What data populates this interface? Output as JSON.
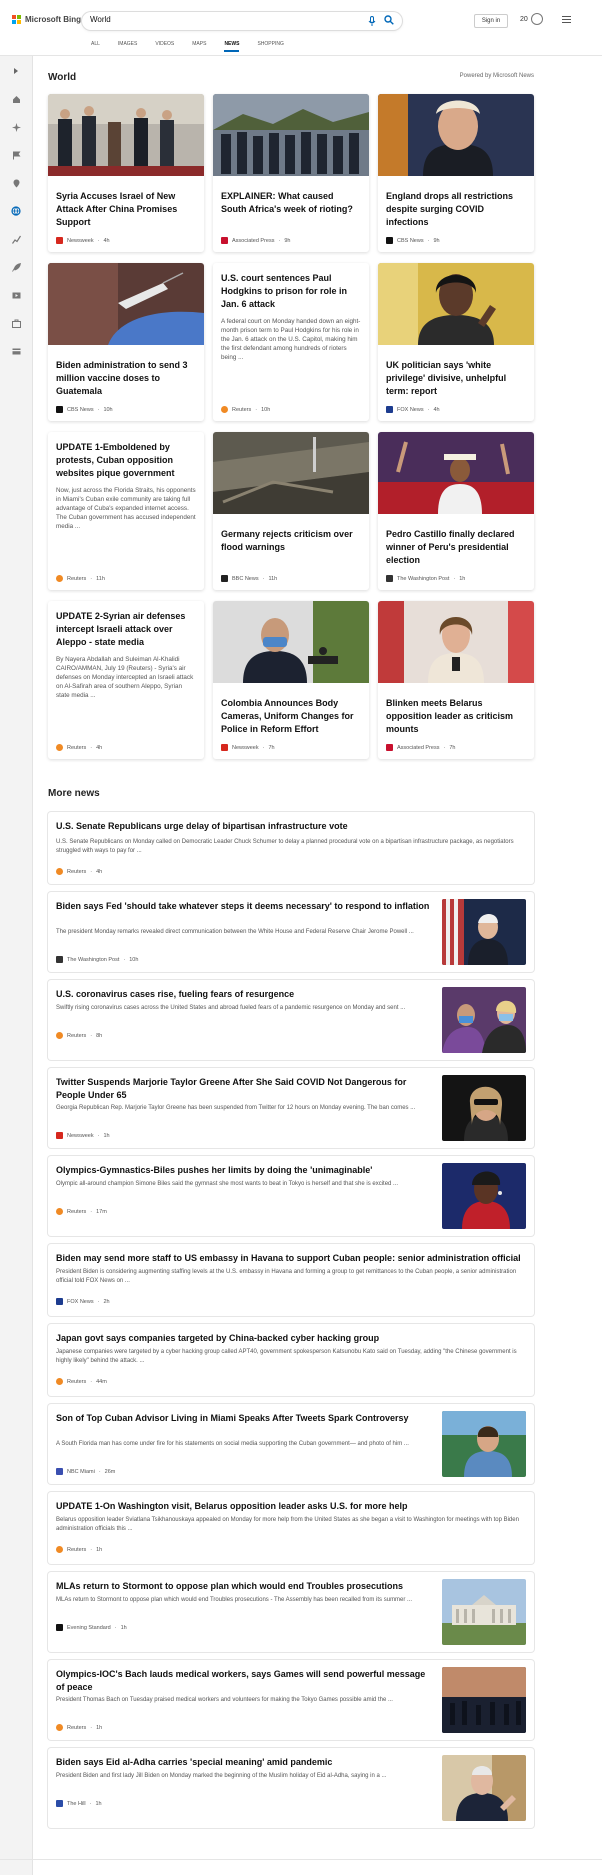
{
  "header": {
    "brand": "Microsoft Bing",
    "search_value": "World",
    "signin": "Sign in",
    "points": "20",
    "tabs": [
      "ALL",
      "IMAGES",
      "VIDEOS",
      "MAPS",
      "NEWS",
      "SHOPPING"
    ],
    "active_tab": "NEWS"
  },
  "section": {
    "title": "World",
    "powered": "Powered by Microsoft News"
  },
  "cards": [
    {
      "title": "Syria Accuses Israel of New Attack After China Promises Support",
      "snippet": "",
      "source": "Newsweek",
      "time": "4h",
      "src_color": "#d6281e",
      "image": "diplomats"
    },
    {
      "title": "EXPLAINER: What caused South Africa's week of rioting?",
      "snippet": "",
      "source": "Associated Press",
      "time": "9h",
      "src_color": "#c8102e",
      "image": "soldiers"
    },
    {
      "title": "England drops all restrictions despite surging COVID infections",
      "snippet": "",
      "source": "CBS News",
      "time": "9h",
      "src_color": "#111111",
      "image": "johnson"
    },
    {
      "title": "Biden administration to send 3 million vaccine doses to Guatemala",
      "snippet": "",
      "source": "CBS News",
      "time": "10h",
      "src_color": "#111111",
      "image": "vaccine"
    },
    {
      "title": "U.S. court sentences Paul Hodgkins to prison for role in Jan. 6 attack",
      "snippet": "A federal court on Monday handed down an eight-month prison term to Paul Hodgkins for his role in the Jan. 6 attack on the U.S. Capitol, making him the first defendant among hundreds of rioters being ...",
      "source": "Reuters",
      "time": "10h",
      "src_color": "#f08a24",
      "image": ""
    },
    {
      "title": "UK politician says 'white privilege' divisive, unhelpful term: report",
      "snippet": "",
      "source": "FOX News",
      "time": "4h",
      "src_color": "#1d3c8f",
      "image": "politician"
    },
    {
      "title": "UPDATE 1-Emboldened by protests, Cuban opposition websites pique government",
      "snippet": "Now, just across the Florida Straits, his opponents in Miami's Cuban exile community are taking full advantage of Cuba's expanded internet access. The Cuban government has accused independent media ...",
      "source": "Reuters",
      "time": "11h",
      "src_color": "#f08a24",
      "image": ""
    },
    {
      "title": "Germany rejects criticism over flood warnings",
      "snippet": "",
      "source": "BBC News",
      "time": "11h",
      "src_color": "#222222",
      "image": "flood"
    },
    {
      "title": "Pedro Castillo finally declared winner of Peru's presidential election",
      "snippet": "",
      "source": "The Washington Post",
      "time": "1h",
      "src_color": "#333333",
      "image": "castillo"
    },
    {
      "title": "UPDATE 2-Syrian air defenses intercept Israeli attack over Aleppo - state media",
      "snippet": "By Nayera Abdallah and Suleiman Al-Khalidi CAIRO/AMMAN, July 19 (Reuters) - Syria's air defenses on Monday intercepted an Israeli attack on Al-Safirah area of southern Aleppo, Syrian state media ...",
      "source": "Reuters",
      "time": "4h",
      "src_color": "#f08a24",
      "image": ""
    },
    {
      "title": "Colombia Announces Body Cameras, Uniform Changes for Police in Reform Effort",
      "snippet": "",
      "source": "Newsweek",
      "time": "7h",
      "src_color": "#d6281e",
      "image": "colombia"
    },
    {
      "title": "Blinken meets Belarus opposition leader as criticism mounts",
      "snippet": "",
      "source": "Associated Press",
      "time": "7h",
      "src_color": "#c8102e",
      "image": "belarus"
    }
  ],
  "more_news": {
    "title": "More news",
    "items": [
      {
        "title": "U.S. Senate Republicans urge delay of bipartisan infrastructure vote",
        "snippet": "U.S. Senate Republicans on Monday called on Democratic Leader Chuck Schumer to delay a planned procedural vote on a bipartisan infrastructure package, as negotiators struggled with ways to pay for ...",
        "source": "Reuters",
        "time": "4h",
        "src_color": "#f08a24",
        "image": ""
      },
      {
        "title": "Biden says Fed 'should take whatever steps it deems necessary' to respond to inflation",
        "snippet": "The president Monday remarks revealed direct communication between the White House and Federal Reserve Chair Jerome Powell ...",
        "source": "The Washington Post",
        "time": "10h",
        "src_color": "#333333",
        "image": "biden-flags"
      },
      {
        "title": "U.S. coronavirus cases rise, fueling fears of resurgence",
        "snippet": "Swiftly rising coronavirus cases across the United States and abroad fueled fears of a pandemic resurgence on Monday and sent ...",
        "source": "Reuters",
        "time": "8h",
        "src_color": "#f08a24",
        "image": "masks"
      },
      {
        "title": "Twitter Suspends Marjorie Taylor Greene After She Said COVID Not Dangerous for People Under 65",
        "snippet": "Georgia Republican Rep. Marjorie Taylor Greene has been suspended from Twitter for 12 hours on Monday evening. The ban comes ...",
        "source": "Newsweek",
        "time": "1h",
        "src_color": "#d6281e",
        "image": "greene"
      },
      {
        "title": "Olympics-Gymnastics-Biles pushes her limits by doing the 'unimaginable'",
        "snippet": "Olympic all-around champion Simone Biles said the gymnast she most wants to beat in Tokyo is herself and that she is excited ...",
        "source": "Reuters",
        "time": "17m",
        "src_color": "#f08a24",
        "image": "biles"
      },
      {
        "title": "Biden may send more staff to US embassy in Havana to support Cuban people: senior administration official",
        "snippet": "President Biden is considering augmenting staffing levels at the U.S. embassy in Havana and forming a group to get remittances to the Cuban people, a senior administration official told FOX News on ...",
        "source": "FOX News",
        "time": "2h",
        "src_color": "#1d3c8f",
        "image": ""
      },
      {
        "title": "Japan govt says companies targeted by China-backed cyber hacking group",
        "snippet": "Japanese companies were targeted by a cyber hacking group called APT40, government spokesperson Katsunobu Kato said on Tuesday, adding \"the Chinese government is highly likely\" behind the attack. ...",
        "source": "Reuters",
        "time": "44m",
        "src_color": "#f08a24",
        "image": ""
      },
      {
        "title": "Son of Top Cuban Advisor Living in Miami Speaks After Tweets Spark Controversy",
        "snippet": "A South Florida man has come under fire for his statements on social media supporting the Cuban government— and photo of him ...",
        "source": "NBC Miami",
        "time": "26m",
        "src_color": "#3a4fb0",
        "image": "miami"
      },
      {
        "title": "UPDATE 1-On Washington visit, Belarus opposition leader asks U.S. for more help",
        "snippet": "Belarus opposition leader Sviatlana Tsikhanouskaya appealed on Monday for more help from the United States as she began a visit to Washington for meetings with top Biden administration officials this ...",
        "source": "Reuters",
        "time": "1h",
        "src_color": "#f08a24",
        "image": ""
      },
      {
        "title": "MLAs return to Stormont to oppose plan which would end Troubles prosecutions",
        "snippet": "MLAs return to Stormont to oppose plan which would end Troubles prosecutions - The Assembly has been recalled from its summer ...",
        "source": "Evening Standard",
        "time": "1h",
        "src_color": "#111111",
        "image": "stormont"
      },
      {
        "title": "Olympics-IOC's Bach lauds medical workers, says Games will send powerful message of peace",
        "snippet": "President Thomas Bach on Tuesday praised medical workers and volunteers for making the Tokyo Games possible amid the ...",
        "source": "Reuters",
        "time": "1h",
        "src_color": "#f08a24",
        "image": "sunset"
      },
      {
        "title": "Biden says Eid al-Adha carries 'special meaning' amid pandemic",
        "snippet": "President Biden and first lady Jill Biden on Monday marked the beginning of the Muslim holiday of Eid al-Adha, saying in a ...",
        "source": "The Hill",
        "time": "1h",
        "src_color": "#2b4da8",
        "image": "biden"
      }
    ]
  },
  "colors": {
    "accent": "#0067b8",
    "rail": "#f3f3f3"
  }
}
